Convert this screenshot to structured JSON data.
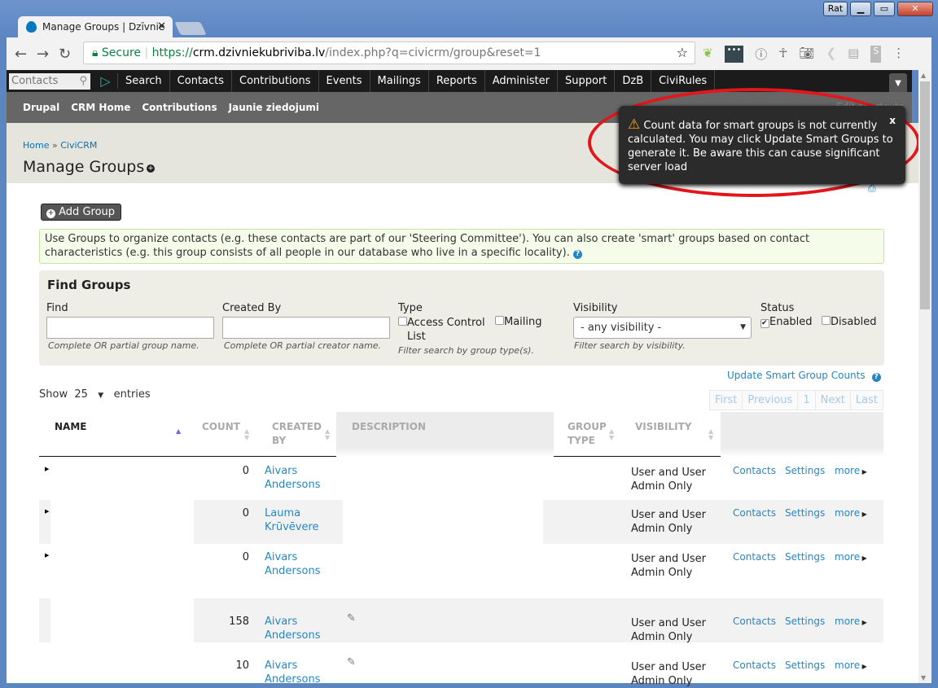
{
  "browser": {
    "tab_title": "Manage Groups | Dzīvnie",
    "user_badge": "Rat",
    "secure_label": "Secure",
    "url_scheme": "https://",
    "url_host": "crm.dzivniekubriviba.lv",
    "url_path": "/index.php?q=civicrm/group&reset=1"
  },
  "civi_menu": {
    "quicksearch_placeholder": "Contacts",
    "items": [
      "Search",
      "Contacts",
      "Contributions",
      "Events",
      "Mailings",
      "Reports",
      "Administer",
      "Support",
      "DzB",
      "CiviRules"
    ]
  },
  "shortcuts": {
    "items": [
      "Drupal",
      "CRM Home",
      "Contributions",
      "Jaunie ziedojumi"
    ],
    "edit_label": "Edit shortcuts"
  },
  "page": {
    "breadcrumb": [
      "Home",
      "CiviCRM"
    ],
    "title": "Manage Groups"
  },
  "alert": {
    "text": "Count data for smart groups is not currently calculated. You may click Update Smart Groups to generate it. Be aware this can cause significant server load",
    "close": "x"
  },
  "add_group": "Add Group",
  "help_text": "Use Groups to organize contacts (e.g. these contacts are part of our 'Steering Committee'). You can also create 'smart' groups based on contact characteristics (e.g. this group consists of all people in our database who live in a specific locality).",
  "find": {
    "title": "Find Groups",
    "find_label": "Find",
    "find_value": "",
    "find_desc": "Complete OR partial group name.",
    "created_label": "Created By",
    "created_value": "",
    "created_desc": "Complete OR partial creator name.",
    "type_label": "Type",
    "type_opt1": "Access Control List",
    "type_opt2": "Mailing",
    "type_desc": "Filter search by group type(s).",
    "vis_label": "Visibility",
    "vis_value": "- any visibility -",
    "vis_desc": "Filter search by visibility.",
    "status_label": "Status",
    "status_enabled": "Enabled",
    "status_enabled_checked": true,
    "status_disabled": "Disabled",
    "status_disabled_checked": false
  },
  "update_counts": "Update Smart Group Counts",
  "show": {
    "prefix": "Show",
    "value": "25",
    "suffix": "entries"
  },
  "pager": [
    "First",
    "Previous",
    "1",
    "Next",
    "Last"
  ],
  "table": {
    "headers": [
      "NAME",
      "COUNT",
      "CREATED BY",
      "DESCRIPTION",
      "GROUP TYPE",
      "VISIBILITY"
    ],
    "rows": [
      {
        "count": "0",
        "creator": "Aivars Andersons",
        "visibility": "User and User Admin Only",
        "actions": [
          "Contacts",
          "Settings",
          "more"
        ]
      },
      {
        "count": "0",
        "creator": "Lauma Krūvēvere",
        "visibility": "User and User Admin Only",
        "actions": [
          "Contacts",
          "Settings",
          "more"
        ]
      },
      {
        "count": "0",
        "creator": "Aivars Andersons",
        "visibility": "User and User Admin Only",
        "actions": [
          "Contacts",
          "Settings",
          "more"
        ]
      },
      {
        "count": "158",
        "creator": "Aivars Andersons",
        "visibility": "User and User Admin Only",
        "actions": [
          "Contacts",
          "Settings",
          "more"
        ]
      },
      {
        "count": "10",
        "creator": "Aivars Andersons",
        "visibility": "User and User Admin Only",
        "actions": [
          "Contacts",
          "Settings",
          "more"
        ]
      }
    ]
  }
}
